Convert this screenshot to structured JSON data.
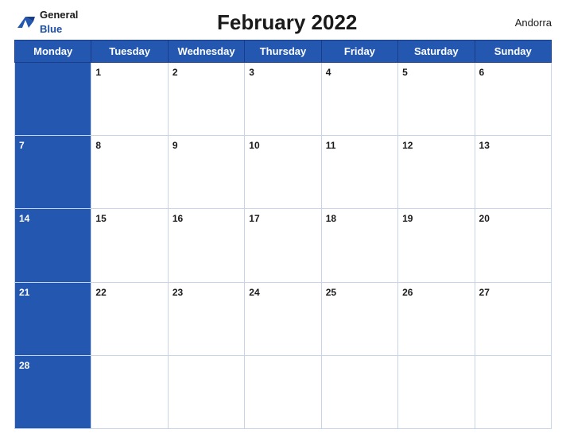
{
  "logo": {
    "general": "General",
    "blue": "Blue"
  },
  "header": {
    "title": "February 2022",
    "region": "Andorra"
  },
  "weekdays": [
    "Monday",
    "Tuesday",
    "Wednesday",
    "Thursday",
    "Friday",
    "Saturday",
    "Sunday"
  ],
  "weeks": [
    [
      {
        "day": "",
        "blue": true
      },
      {
        "day": "1",
        "blue": false
      },
      {
        "day": "2",
        "blue": false
      },
      {
        "day": "3",
        "blue": false
      },
      {
        "day": "4",
        "blue": false
      },
      {
        "day": "5",
        "blue": false
      },
      {
        "day": "6",
        "blue": false
      }
    ],
    [
      {
        "day": "7",
        "blue": true
      },
      {
        "day": "8",
        "blue": false
      },
      {
        "day": "9",
        "blue": false
      },
      {
        "day": "10",
        "blue": false
      },
      {
        "day": "11",
        "blue": false
      },
      {
        "day": "12",
        "blue": false
      },
      {
        "day": "13",
        "blue": false
      }
    ],
    [
      {
        "day": "14",
        "blue": true
      },
      {
        "day": "15",
        "blue": false
      },
      {
        "day": "16",
        "blue": false
      },
      {
        "day": "17",
        "blue": false
      },
      {
        "day": "18",
        "blue": false
      },
      {
        "day": "19",
        "blue": false
      },
      {
        "day": "20",
        "blue": false
      }
    ],
    [
      {
        "day": "21",
        "blue": true
      },
      {
        "day": "22",
        "blue": false
      },
      {
        "day": "23",
        "blue": false
      },
      {
        "day": "24",
        "blue": false
      },
      {
        "day": "25",
        "blue": false
      },
      {
        "day": "26",
        "blue": false
      },
      {
        "day": "27",
        "blue": false
      }
    ],
    [
      {
        "day": "28",
        "blue": true
      },
      {
        "day": "",
        "blue": false
      },
      {
        "day": "",
        "blue": false
      },
      {
        "day": "",
        "blue": false
      },
      {
        "day": "",
        "blue": false
      },
      {
        "day": "",
        "blue": false
      },
      {
        "day": "",
        "blue": false
      }
    ]
  ]
}
